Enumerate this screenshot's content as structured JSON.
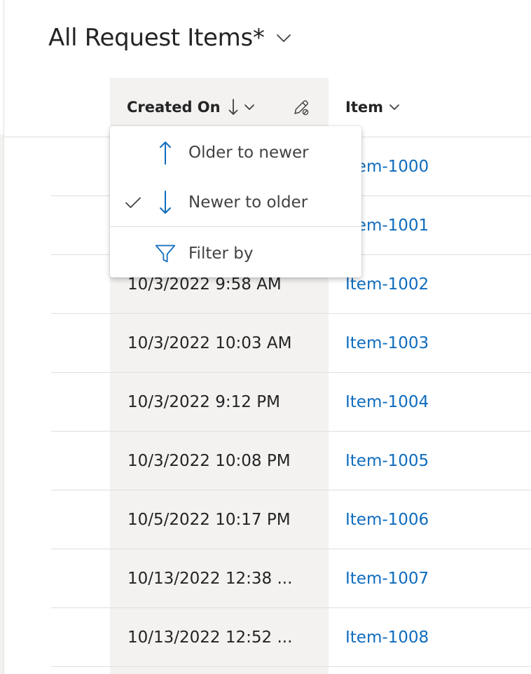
{
  "view": {
    "title": "All Request Items*"
  },
  "columns": {
    "created_on": "Created On",
    "item": "Item"
  },
  "sort_menu": {
    "items": [
      {
        "label": "Older to newer",
        "icon": "arrow-up-icon",
        "checked": false
      },
      {
        "label": "Newer to older",
        "icon": "arrow-down-icon",
        "checked": true
      },
      {
        "label": "Filter by",
        "icon": "filter-icon",
        "checked": false
      }
    ]
  },
  "rows": [
    {
      "created_on": "",
      "item": "Item-1000"
    },
    {
      "created_on": "",
      "item": "Item-1001"
    },
    {
      "created_on": "10/3/2022 9:58 AM",
      "item": "Item-1002"
    },
    {
      "created_on": "10/3/2022 10:03 AM",
      "item": "Item-1003"
    },
    {
      "created_on": "10/3/2022 9:12 PM",
      "item": "Item-1004"
    },
    {
      "created_on": "10/3/2022 10:08 PM",
      "item": "Item-1005"
    },
    {
      "created_on": "10/5/2022 10:17 PM",
      "item": "Item-1006"
    },
    {
      "created_on": "10/13/2022 12:38 ...",
      "item": "Item-1007"
    },
    {
      "created_on": "10/13/2022 12:52 ...",
      "item": "Item-1008"
    }
  ],
  "colors": {
    "link": "#0f6cbd",
    "accent": "#0f6cbd",
    "column_shade": "#f3f2f1",
    "divider": "#e1dfdd",
    "text": "#242424"
  }
}
